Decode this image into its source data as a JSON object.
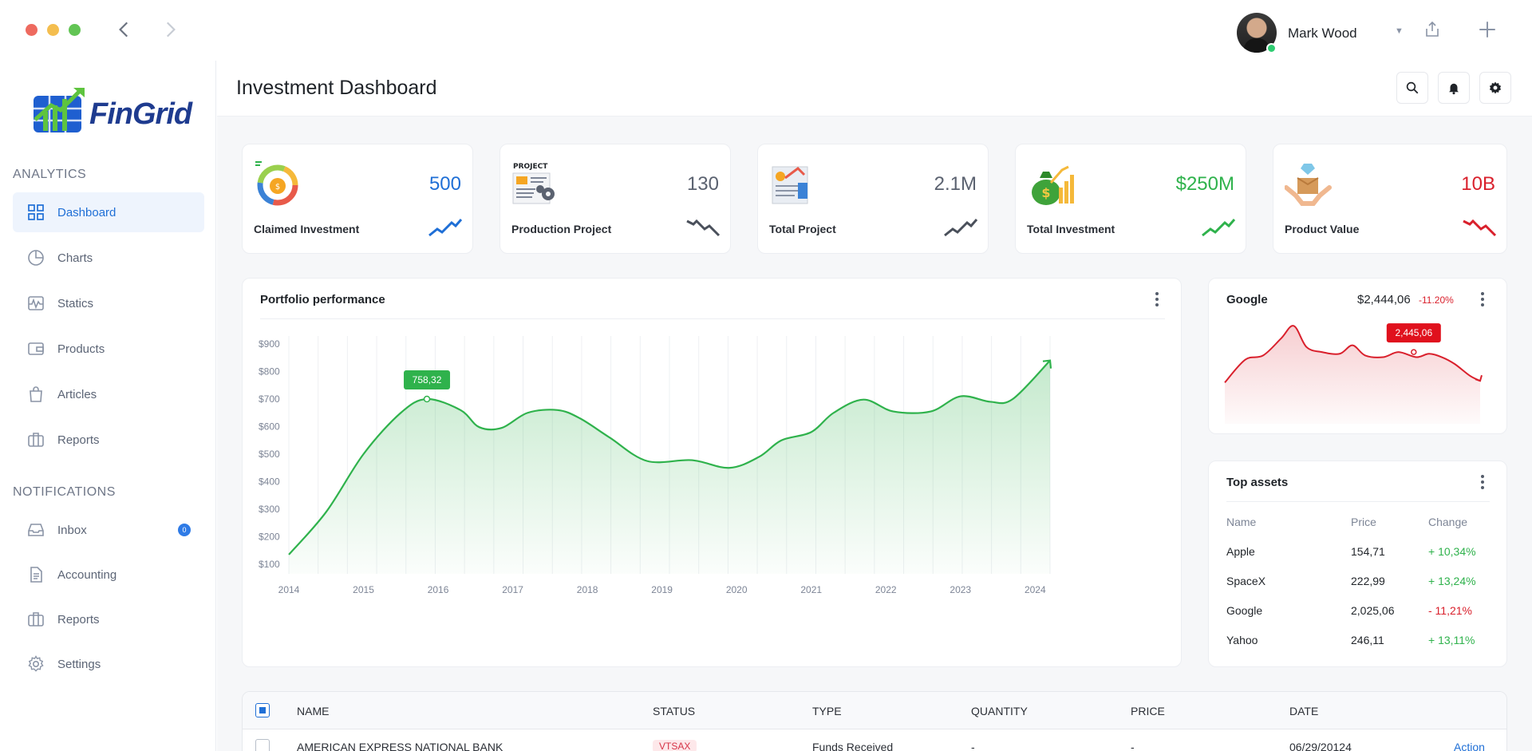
{
  "user": {
    "name": "Mark Wood"
  },
  "sidebar": {
    "logo": "FinGrid",
    "analytics_label": "ANALYTICS",
    "analytics_items": [
      {
        "label": "Dashboard",
        "icon": "grid-icon",
        "active": true
      },
      {
        "label": "Charts",
        "icon": "pie-chart-icon"
      },
      {
        "label": "Statics",
        "icon": "activity-icon"
      },
      {
        "label": "Products",
        "icon": "wallet-icon"
      },
      {
        "label": "Articles",
        "icon": "bag-icon"
      },
      {
        "label": "Reports",
        "icon": "briefcase-icon"
      }
    ],
    "notifications_label": "NOTIFICATIONS",
    "notification_items": [
      {
        "label": "Inbox",
        "icon": "inbox-icon",
        "badge": "0"
      },
      {
        "label": "Accounting",
        "icon": "document-icon"
      },
      {
        "label": "Reports",
        "icon": "briefcase-icon"
      },
      {
        "label": "Settings",
        "icon": "gear-icon"
      }
    ]
  },
  "header": {
    "title": "Investment Dashboard"
  },
  "stats": [
    {
      "value": "500",
      "label": "Claimed Investment",
      "color": "#1f6fd6",
      "trend": "up",
      "icon_text": ""
    },
    {
      "value": "130",
      "label": "Production Project",
      "color": "#5b6270",
      "trend": "down",
      "icon_text": "PROJECT"
    },
    {
      "value": "2.1M",
      "label": "Total Project",
      "color": "#5b6270",
      "trend": "up"
    },
    {
      "value": "$250M",
      "label": "Total Investment",
      "color": "#2fb24c",
      "trend": "up"
    },
    {
      "value": "10B",
      "label": "Product Value",
      "color": "#d9202c",
      "trend": "down"
    }
  ],
  "portfolio": {
    "title": "Portfolio performance",
    "tooltip": "758,32"
  },
  "chart_data": {
    "type": "area",
    "x_ticks": [
      "2014",
      "2015",
      "2016",
      "2017",
      "2018",
      "2019",
      "2020",
      "2021",
      "2022",
      "2023",
      "2024"
    ],
    "y_ticks": [
      "$100",
      "$200",
      "$300",
      "$400",
      "$500",
      "$600",
      "$700",
      "$800",
      "$900"
    ],
    "ylim": [
      100,
      900
    ],
    "xlim": [
      2014,
      2024.2
    ],
    "series": [
      {
        "color": "#2fb24c",
        "points": [
          [
            2014.0,
            135
          ],
          [
            2014.5,
            290
          ],
          [
            2015.0,
            500
          ],
          [
            2015.5,
            650
          ],
          [
            2015.85,
            700
          ],
          [
            2016.3,
            660
          ],
          [
            2016.55,
            598
          ],
          [
            2016.85,
            595
          ],
          [
            2017.2,
            650
          ],
          [
            2017.6,
            660
          ],
          [
            2017.9,
            630
          ],
          [
            2018.3,
            560
          ],
          [
            2018.8,
            475
          ],
          [
            2019.4,
            478
          ],
          [
            2019.9,
            450
          ],
          [
            2020.3,
            490
          ],
          [
            2020.6,
            550
          ],
          [
            2021.0,
            580
          ],
          [
            2021.3,
            650
          ],
          [
            2021.7,
            698
          ],
          [
            2022.1,
            655
          ],
          [
            2022.6,
            655
          ],
          [
            2023.0,
            710
          ],
          [
            2023.4,
            690
          ],
          [
            2023.7,
            700
          ],
          [
            2024.2,
            840
          ]
        ]
      }
    ],
    "highlight": {
      "x": 2015.85,
      "y": 700,
      "label": "758,32"
    }
  },
  "google": {
    "title": "Google",
    "price": "$2,444,06",
    "change": "-11.20%",
    "tooltip": "2,445,06"
  },
  "google_chart_data": {
    "type": "area",
    "color": "#d9202c",
    "points": [
      [
        0,
        28
      ],
      [
        8,
        55
      ],
      [
        15,
        60
      ],
      [
        22,
        80
      ],
      [
        27,
        95
      ],
      [
        32,
        70
      ],
      [
        38,
        64
      ],
      [
        45,
        62
      ],
      [
        50,
        72
      ],
      [
        55,
        60
      ],
      [
        62,
        58
      ],
      [
        68,
        64
      ],
      [
        75,
        58
      ],
      [
        80,
        62
      ],
      [
        85,
        58
      ],
      [
        90,
        50
      ],
      [
        96,
        36
      ],
      [
        100,
        30
      ]
    ],
    "highlight": {
      "x": 74,
      "y": 64
    }
  },
  "top_assets": {
    "title": "Top assets",
    "headers": [
      "Name",
      "Price",
      "Change"
    ],
    "rows": [
      {
        "name": "Apple",
        "price": "154,71",
        "change": "+ 10,34%",
        "positive": true
      },
      {
        "name": "SpaceX",
        "price": "222,99",
        "change": "+ 13,24%",
        "positive": true
      },
      {
        "name": "Google",
        "price": "2,025,06",
        "change": "- 11,21%",
        "positive": false
      },
      {
        "name": "Yahoo",
        "price": "246,11",
        "change": "+ 13,11%",
        "positive": true
      }
    ]
  },
  "transactions": {
    "headers": [
      "NAME",
      "STATUS",
      "TYPE",
      "QUANTITY",
      "PRICE",
      "DATE"
    ],
    "rows": [
      {
        "name": "AMERICAN EXPRESS NATIONAL BANK",
        "status": "VTSAX",
        "type": "Funds Received",
        "quantity": "-",
        "price": "-",
        "date": "06/29/20124",
        "action": "Action"
      }
    ]
  }
}
